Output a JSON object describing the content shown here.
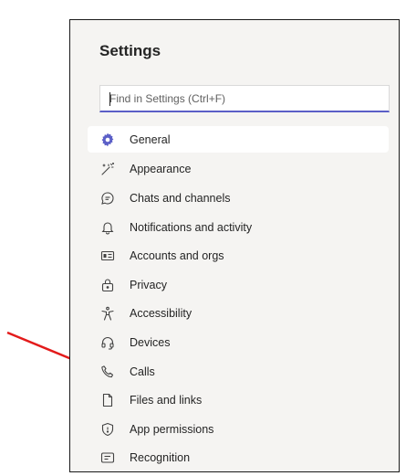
{
  "settings": {
    "title": "Settings",
    "search_placeholder": "Find in Settings (Ctrl+F)",
    "accent_color": "#5b5fc7",
    "arrow_color": "#e31b1b",
    "items": [
      {
        "label": "General",
        "icon": "gear-icon",
        "active": true
      },
      {
        "label": "Appearance",
        "icon": "magic-wand-icon",
        "active": false
      },
      {
        "label": "Chats and channels",
        "icon": "chat-icon",
        "active": false
      },
      {
        "label": "Notifications and activity",
        "icon": "bell-icon",
        "active": false
      },
      {
        "label": "Accounts and orgs",
        "icon": "id-card-icon",
        "active": false
      },
      {
        "label": "Privacy",
        "icon": "lock-icon",
        "active": false
      },
      {
        "label": "Accessibility",
        "icon": "accessibility-icon",
        "active": false
      },
      {
        "label": "Devices",
        "icon": "headset-icon",
        "active": false
      },
      {
        "label": "Calls",
        "icon": "phone-icon",
        "active": false
      },
      {
        "label": "Files and links",
        "icon": "file-icon",
        "active": false
      },
      {
        "label": "App permissions",
        "icon": "shield-icon",
        "active": false
      },
      {
        "label": "Recognition",
        "icon": "recognition-icon",
        "active": false
      }
    ]
  }
}
